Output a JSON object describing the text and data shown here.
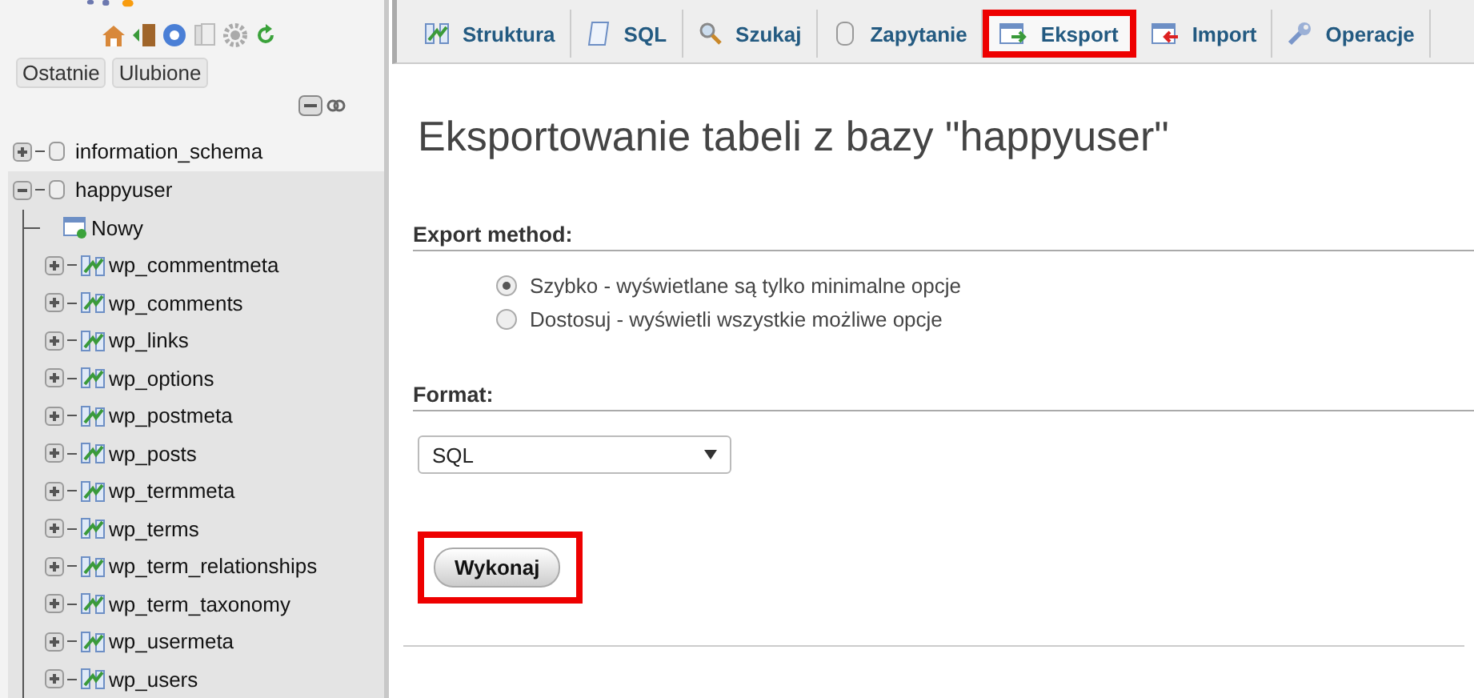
{
  "sidebar": {
    "quick_links": [
      "Ostatnie",
      "Ulubione"
    ],
    "databases": [
      {
        "name": "information_schema",
        "expanded": false,
        "selected": false
      },
      {
        "name": "happyuser",
        "expanded": true,
        "selected": true,
        "children": [
          {
            "name": "Nowy",
            "kind": "new"
          },
          {
            "name": "wp_commentmeta",
            "kind": "table"
          },
          {
            "name": "wp_comments",
            "kind": "table"
          },
          {
            "name": "wp_links",
            "kind": "table"
          },
          {
            "name": "wp_options",
            "kind": "table"
          },
          {
            "name": "wp_postmeta",
            "kind": "table"
          },
          {
            "name": "wp_posts",
            "kind": "table"
          },
          {
            "name": "wp_termmeta",
            "kind": "table"
          },
          {
            "name": "wp_terms",
            "kind": "table"
          },
          {
            "name": "wp_term_relationships",
            "kind": "table"
          },
          {
            "name": "wp_term_taxonomy",
            "kind": "table"
          },
          {
            "name": "wp_usermeta",
            "kind": "table"
          },
          {
            "name": "wp_users",
            "kind": "table"
          }
        ]
      }
    ]
  },
  "tabs": [
    {
      "label": "Struktura",
      "kind": "structure",
      "highlighted": false
    },
    {
      "label": "SQL",
      "kind": "sql",
      "highlighted": false
    },
    {
      "label": "Szukaj",
      "kind": "search",
      "highlighted": false
    },
    {
      "label": "Zapytanie",
      "kind": "query",
      "highlighted": false
    },
    {
      "label": "Eksport",
      "kind": "export",
      "highlighted": true
    },
    {
      "label": "Import",
      "kind": "import",
      "highlighted": false
    },
    {
      "label": "Operacje",
      "kind": "operations",
      "highlighted": false
    }
  ],
  "page_title": "Eksportowanie tabeli z bazy \"happyuser\"",
  "export_method": {
    "heading": "Export method:",
    "options": [
      {
        "label": "Szybko - wyświetlane są tylko minimalne opcje",
        "selected": true
      },
      {
        "label": "Dostosuj - wyświetli wszystkie możliwe opcje",
        "selected": false
      }
    ]
  },
  "format": {
    "heading": "Format:",
    "value": "SQL"
  },
  "submit": {
    "label": "Wykonaj",
    "highlighted": true
  }
}
